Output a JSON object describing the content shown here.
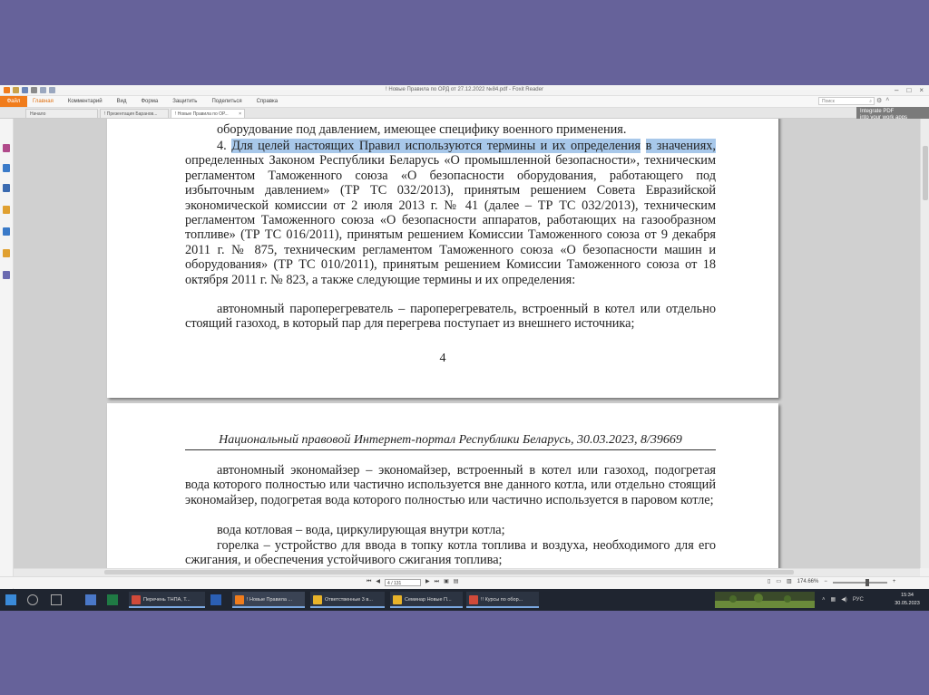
{
  "window": {
    "title": "! Новые Правила по ОРД от 27.12.2022 №84.pdf - Foxit Reader"
  },
  "ribbon": {
    "file_tab": "Файл",
    "tabs": [
      "Главная",
      "Комментарий",
      "Вид",
      "Форма",
      "Защитить",
      "Поделиться",
      "Справка"
    ],
    "search_placeholder": "Поиск"
  },
  "doc_tabs": [
    {
      "label": "Начало"
    },
    {
      "label": "! Презентация Баранов..."
    },
    {
      "label": "! Новые Правила по ОР..."
    }
  ],
  "promo_text": [
    "Integrate PDF",
    "into your work apps"
  ],
  "document": {
    "page1": {
      "line_top": "оборудование под давлением, имеющее специфику военного применения.",
      "para4_highlighted_1": "Для целей настоящих Правил используются термины и их определения",
      "para4_prefix": "4.",
      "para4_highlighted_2": "в значениях,",
      "para4_rest": "определенных Законом Республики Беларусь «О промышленной безопасности», техническим регламентом Таможенного союза «О безопасности оборудования, работающего под избыточным давлением» (ТР ТС 032/2013), принятым решением Совета Евразийской экономической комиссии от 2 июля 2013 г. № 41 (далее – ТР ТС 032/2013), техническим регламентом Таможенного союза «О безопасности аппаратов, работающих на газообразном топливе» (ТР ТС 016/2011), принятым решением Комиссии Таможенного союза от 9 декабря 2011 г. № 875, техническим регламентом Таможенного союза «О безопасности машин и оборудования» (ТР ТС 010/2011), принятым решением Комиссии Таможенного союза от 18 октября 2011 г. № 823, а также следующие термины и их определения:",
      "para_autonomous": "автономный пароперегреватель – пароперегреватель, встроенный в котел или отдельно стоящий газоход, в который пар для перегрева поступает из внешнего источника;",
      "page_number": "4"
    },
    "page2": {
      "header": "Национальный правовой Интернет-портал Республики Беларусь, 30.03.2023, 8/39669",
      "para_economizer": "автономный экономайзер – экономайзер, встроенный в котел или газоход, подогретая вода которого полностью или частично используется вне данного котла, или отдельно стоящий экономайзер, подогретая вода которого полностью или частично используется в паровом котле;",
      "para_water": "вода котловая – вода, циркулирующая внутри котла;",
      "para_burner": "горелка – устройство для ввода в топку котла топлива и воздуха, необходимого для его сжигания, и обеспечения устойчивого сжигания топлива;"
    }
  },
  "statusbar": {
    "page_field": "4 / 131",
    "zoom": "174.66%"
  },
  "taskbar": {
    "buttons": [
      {
        "label": "Перечень ТНПА, Т...",
        "color": "#d04a3a"
      },
      {
        "label": "! Новые Правила ...",
        "color": "#f07c1c"
      },
      {
        "label": "Ответственные 3 в...",
        "color": "#e8b32a"
      },
      {
        "label": "Семинар Новые П...",
        "color": "#e8b32a"
      },
      {
        "label": "!! Курсы по обор...",
        "color": "#d04a3a"
      }
    ],
    "lang": "РУС",
    "time": "15:34",
    "date": "30.05.2023"
  }
}
